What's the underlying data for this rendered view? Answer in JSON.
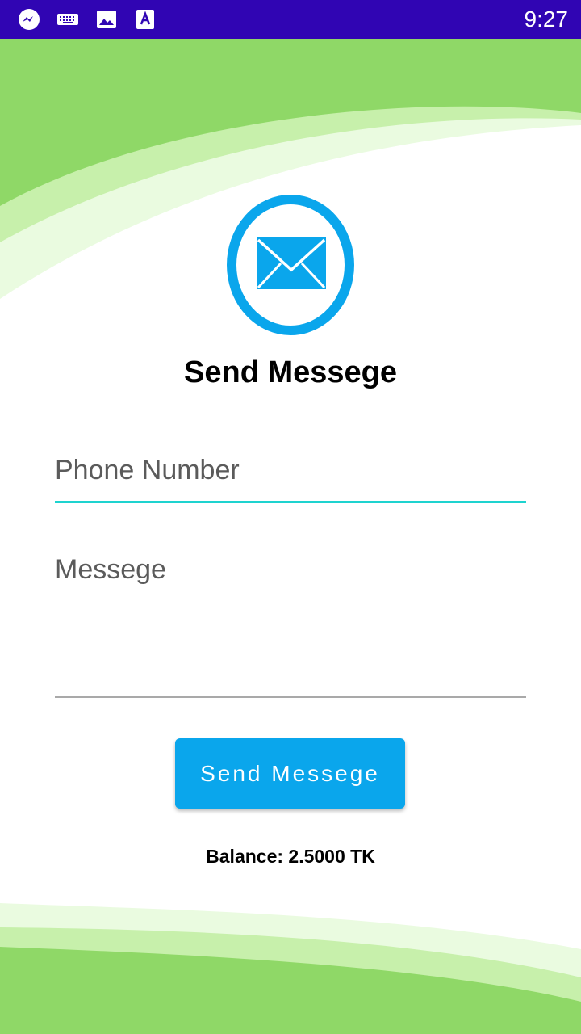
{
  "status_bar": {
    "time": "9:27",
    "icons": [
      "messenger-icon",
      "keyboard-icon",
      "image-icon",
      "text-a-icon"
    ],
    "background_color": "#3005b3"
  },
  "app": {
    "title": "Send Messege",
    "logo_icon": "envelope-icon",
    "accent_color": "#0aa6ec",
    "background_color": "#8fd867"
  },
  "form": {
    "phone_placeholder": "Phone Number",
    "message_placeholder": "Messege",
    "send_button_label": "Send Messege",
    "focused_line_color": "#1ed3cf"
  },
  "balance_text": "Balance: 2.5000 TK"
}
